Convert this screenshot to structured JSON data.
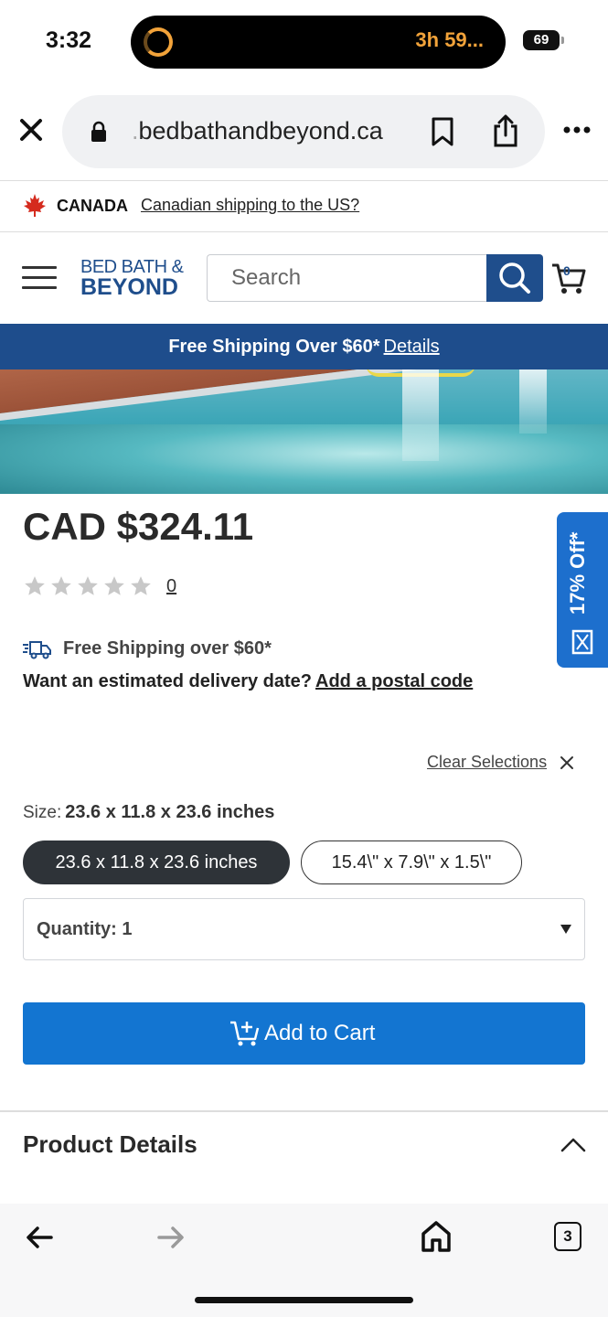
{
  "status_bar": {
    "time": "3:32",
    "timer": "3h 59...",
    "battery": "69"
  },
  "browser": {
    "url_faded": ".",
    "url": "bedbathandbeyond.ca",
    "tab_count": "3"
  },
  "country_bar": {
    "country": "CANADA",
    "link": "Canadian shipping to the US?"
  },
  "header": {
    "logo_line1": "BED BATH &",
    "logo_line2": "BEYOND",
    "search_placeholder": "Search",
    "cart_count": "0"
  },
  "banner": {
    "text": "Free Shipping Over $60*",
    "link": "Details"
  },
  "product": {
    "price": "CAD $324.11",
    "rating": 0,
    "review_count": "0",
    "promo": "17% Off*",
    "free_shipping": "Free Shipping over $60*",
    "delivery_question": "Want an estimated delivery date?",
    "delivery_link": "Add a postal code",
    "clear_selections": "Clear Selections",
    "size_label": "Size:",
    "size_value": "23.6 x 11.8 x 23.6 inches",
    "size_options": [
      "23.6 x 11.8 x 23.6 inches",
      "15.4\\\" x 7.9\\\" x 1.5\\\""
    ],
    "quantity_label": "Quantity: 1",
    "add_to_cart": "Add to Cart",
    "details_title": "Product Details"
  },
  "colors": {
    "brand_blue": "#1f4e8c",
    "cta_blue": "#1375d1",
    "promo_blue": "#1d6fcd"
  }
}
